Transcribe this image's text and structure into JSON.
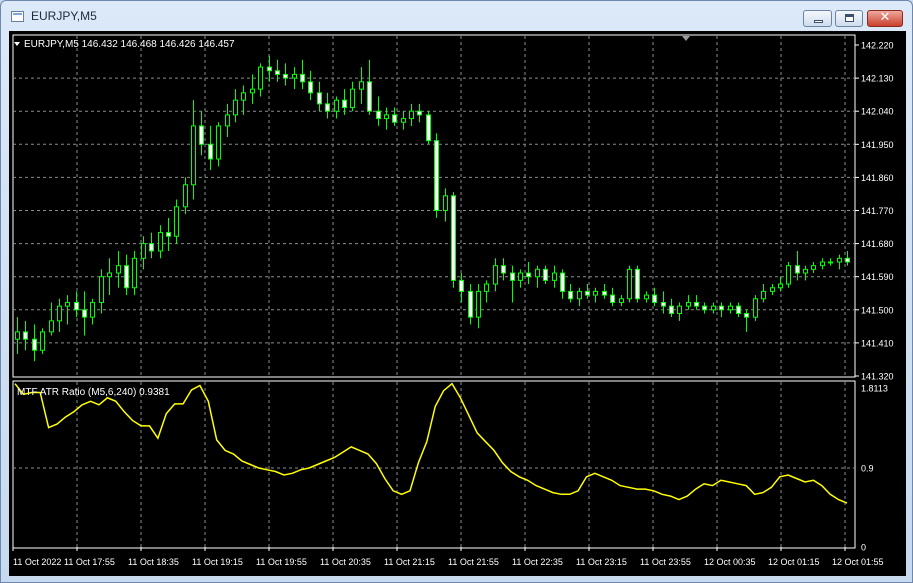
{
  "window": {
    "title": "EURJPY,M5"
  },
  "main_panel": {
    "info_label": "EURJPY,M5  146.432 146.468 146.426 146.457"
  },
  "sub_panel": {
    "info_label": "MTF ATR Ratio  (M5,6,240) 0.9381"
  },
  "colors": {
    "background": "#000000",
    "grid": "#8c8c8c",
    "candle": "#00ff00",
    "bull_body": "#000000",
    "bear_body": "#ffffff",
    "indicator": "#ffff00",
    "text": "#ffffff"
  },
  "chart_data": [
    {
      "type": "candlestick",
      "symbol": "EURJPY",
      "timeframe": "M5",
      "ylim": [
        141.32,
        142.22
      ],
      "y_ticks": [
        "142.220",
        "142.130",
        "142.040",
        "141.950",
        "141.860",
        "141.770",
        "141.680",
        "141.590",
        "141.500",
        "141.410",
        "141.320"
      ],
      "x_ticks": [
        "11 Oct 2022",
        "11 Oct 17:55",
        "11 Oct 18:35",
        "11 Oct 19:15",
        "11 Oct 19:55",
        "11 Oct 20:35",
        "11 Oct 21:15",
        "11 Oct 21:55",
        "11 Oct 22:35",
        "11 Oct 23:15",
        "11 Oct 23:55",
        "12 Oct 00:35",
        "12 Oct 01:15",
        "12 Oct 01:55"
      ],
      "grid": true,
      "ohlc": [
        [
          141.42,
          141.48,
          141.38,
          141.44
        ],
        [
          141.44,
          141.47,
          141.39,
          141.42
        ],
        [
          141.42,
          141.46,
          141.36,
          141.39
        ],
        [
          141.39,
          141.45,
          141.38,
          141.44
        ],
        [
          141.44,
          141.52,
          141.43,
          141.47
        ],
        [
          141.47,
          141.53,
          141.44,
          141.51
        ],
        [
          141.51,
          141.54,
          141.46,
          141.52
        ],
        [
          141.52,
          141.55,
          141.48,
          141.5
        ],
        [
          141.5,
          141.55,
          141.43,
          141.48
        ],
        [
          141.48,
          141.53,
          141.46,
          141.52
        ],
        [
          141.52,
          141.61,
          141.49,
          141.59
        ],
        [
          141.59,
          141.64,
          141.54,
          141.6
        ],
        [
          141.6,
          141.66,
          141.56,
          141.62
        ],
        [
          141.62,
          141.65,
          141.54,
          141.56
        ],
        [
          141.56,
          141.66,
          141.54,
          141.64
        ],
        [
          141.64,
          141.7,
          141.61,
          141.68
        ],
        [
          141.68,
          141.71,
          141.64,
          141.66
        ],
        [
          141.66,
          141.73,
          141.64,
          141.71
        ],
        [
          141.71,
          141.75,
          141.66,
          141.7
        ],
        [
          141.7,
          141.8,
          141.68,
          141.78
        ],
        [
          141.78,
          141.86,
          141.76,
          141.84
        ],
        [
          141.84,
          142.07,
          141.8,
          142.0
        ],
        [
          142.0,
          142.04,
          141.92,
          141.95
        ],
        [
          141.95,
          142.0,
          141.88,
          141.91
        ],
        [
          141.91,
          142.01,
          141.89,
          142.0
        ],
        [
          142.0,
          142.06,
          141.97,
          142.03
        ],
        [
          142.03,
          142.1,
          142.01,
          142.07
        ],
        [
          142.07,
          142.11,
          142.03,
          142.09
        ],
        [
          142.09,
          142.14,
          142.06,
          142.1
        ],
        [
          142.1,
          142.17,
          142.08,
          142.16
        ],
        [
          142.16,
          142.19,
          142.12,
          142.15
        ],
        [
          142.15,
          142.18,
          142.12,
          142.14
        ],
        [
          142.14,
          142.17,
          142.11,
          142.13
        ],
        [
          142.13,
          142.16,
          142.1,
          142.14
        ],
        [
          142.14,
          142.18,
          142.1,
          142.12
        ],
        [
          142.12,
          142.15,
          142.07,
          142.09
        ],
        [
          142.09,
          142.12,
          142.04,
          142.06
        ],
        [
          142.06,
          142.09,
          142.02,
          142.04
        ],
        [
          142.04,
          142.08,
          142.02,
          142.07
        ],
        [
          142.07,
          142.1,
          142.03,
          142.05
        ],
        [
          142.05,
          142.12,
          142.04,
          142.1
        ],
        [
          142.1,
          142.16,
          142.06,
          142.12
        ],
        [
          142.12,
          142.18,
          142.03,
          142.04
        ],
        [
          142.04,
          142.08,
          142.0,
          142.02
        ],
        [
          142.02,
          142.05,
          141.99,
          142.03
        ],
        [
          142.03,
          142.05,
          142.0,
          142.01
        ],
        [
          142.01,
          142.04,
          141.99,
          142.02
        ],
        [
          142.02,
          142.06,
          142.0,
          142.04
        ],
        [
          142.04,
          142.06,
          142.01,
          142.03
        ],
        [
          142.03,
          142.04,
          141.95,
          141.96
        ],
        [
          141.96,
          141.98,
          141.75,
          141.77
        ],
        [
          141.77,
          141.83,
          141.74,
          141.81
        ],
        [
          141.81,
          141.82,
          141.56,
          141.58
        ],
        [
          141.58,
          141.6,
          141.52,
          141.55
        ],
        [
          141.55,
          141.57,
          141.46,
          141.48
        ],
        [
          141.48,
          141.57,
          141.45,
          141.55
        ],
        [
          141.55,
          141.58,
          141.52,
          141.57
        ],
        [
          141.57,
          141.64,
          141.55,
          141.62
        ],
        [
          141.62,
          141.64,
          141.58,
          141.6
        ],
        [
          141.6,
          141.62,
          141.52,
          141.58
        ],
        [
          141.58,
          141.61,
          141.56,
          141.6
        ],
        [
          141.6,
          141.63,
          141.57,
          141.59
        ],
        [
          141.59,
          141.62,
          141.56,
          141.61
        ],
        [
          141.61,
          141.62,
          141.57,
          141.58
        ],
        [
          141.58,
          141.62,
          141.56,
          141.6
        ],
        [
          141.6,
          141.61,
          141.53,
          141.55
        ],
        [
          141.55,
          141.57,
          141.52,
          141.53
        ],
        [
          141.53,
          141.56,
          141.51,
          141.55
        ],
        [
          141.55,
          141.57,
          141.53,
          141.54
        ],
        [
          141.54,
          141.56,
          141.52,
          141.55
        ],
        [
          141.55,
          141.57,
          141.53,
          141.54
        ],
        [
          141.54,
          141.56,
          141.51,
          141.52
        ],
        [
          141.52,
          141.54,
          141.51,
          141.53
        ],
        [
          141.53,
          141.62,
          141.52,
          141.61
        ],
        [
          141.61,
          141.62,
          141.52,
          141.53
        ],
        [
          141.53,
          141.55,
          141.52,
          141.54
        ],
        [
          141.54,
          141.56,
          141.51,
          141.52
        ],
        [
          141.52,
          141.55,
          141.49,
          141.51
        ],
        [
          141.51,
          141.53,
          141.48,
          141.49
        ],
        [
          141.49,
          141.52,
          141.47,
          141.51
        ],
        [
          141.51,
          141.54,
          141.5,
          141.52
        ],
        [
          141.52,
          141.54,
          141.5,
          141.51
        ],
        [
          141.51,
          141.52,
          141.49,
          141.5
        ],
        [
          141.5,
          141.52,
          141.49,
          141.51
        ],
        [
          141.51,
          141.52,
          141.48,
          141.5
        ],
        [
          141.5,
          141.52,
          141.49,
          141.51
        ],
        [
          141.51,
          141.52,
          141.48,
          141.49
        ],
        [
          141.49,
          141.5,
          141.44,
          141.48
        ],
        [
          141.48,
          141.54,
          141.47,
          141.53
        ],
        [
          141.53,
          141.57,
          141.52,
          141.55
        ],
        [
          141.55,
          141.57,
          141.54,
          141.56
        ],
        [
          141.56,
          141.59,
          141.55,
          141.57
        ],
        [
          141.57,
          141.63,
          141.56,
          141.62
        ],
        [
          141.62,
          141.66,
          141.58,
          141.6
        ],
        [
          141.6,
          141.62,
          141.58,
          141.61
        ],
        [
          141.61,
          141.63,
          141.6,
          141.62
        ],
        [
          141.62,
          141.64,
          141.61,
          141.63
        ],
        [
          141.63,
          141.64,
          141.62,
          141.63
        ],
        [
          141.63,
          141.65,
          141.61,
          141.64
        ],
        [
          141.64,
          141.66,
          141.62,
          141.63
        ]
      ]
    },
    {
      "type": "line",
      "series": [
        {
          "name": "MTF ATR Ratio",
          "values": [
            1.86,
            1.74,
            1.76,
            1.76,
            1.36,
            1.4,
            1.48,
            1.54,
            1.62,
            1.66,
            1.62,
            1.7,
            1.66,
            1.54,
            1.44,
            1.38,
            1.38,
            1.24,
            1.52,
            1.63,
            1.63,
            1.79,
            1.84,
            1.66,
            1.22,
            1.1,
            1.06,
            0.98,
            0.94,
            0.9,
            0.88,
            0.86,
            0.82,
            0.84,
            0.88,
            0.9,
            0.94,
            0.98,
            1.02,
            1.08,
            1.14,
            1.1,
            1.06,
            0.95,
            0.78,
            0.64,
            0.6,
            0.64,
            0.96,
            1.2,
            1.6,
            1.78,
            1.86,
            1.7,
            1.5,
            1.3,
            1.2,
            1.1,
            0.96,
            0.86,
            0.8,
            0.76,
            0.7,
            0.66,
            0.62,
            0.6,
            0.6,
            0.64,
            0.8,
            0.84,
            0.8,
            0.76,
            0.7,
            0.68,
            0.66,
            0.66,
            0.64,
            0.6,
            0.58,
            0.54,
            0.58,
            0.66,
            0.72,
            0.7,
            0.76,
            0.74,
            0.72,
            0.7,
            0.6,
            0.62,
            0.68,
            0.8,
            0.82,
            0.78,
            0.74,
            0.76,
            0.7,
            0.6,
            0.54,
            0.5
          ]
        }
      ],
      "ylim": [
        0,
        1.8113
      ],
      "y_ticks": [
        "1.8113",
        "0.9",
        "0"
      ],
      "grid": true
    }
  ]
}
